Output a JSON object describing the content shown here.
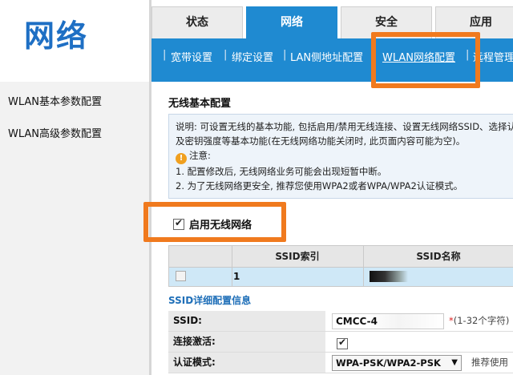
{
  "brand": {
    "title": "网络"
  },
  "sidebar": {
    "items": [
      {
        "label": "WLAN基本参数配置"
      },
      {
        "label": "WLAN高级参数配置"
      }
    ]
  },
  "tabs": [
    {
      "label": "状态"
    },
    {
      "label": "网络"
    },
    {
      "label": "安全"
    },
    {
      "label": "应用"
    }
  ],
  "subnav": {
    "items": [
      {
        "label": "宽带设置"
      },
      {
        "label": "绑定设置"
      },
      {
        "label": "LAN侧地址配置"
      },
      {
        "label": "WLAN网络配置"
      },
      {
        "label": "远程管理"
      }
    ]
  },
  "section": {
    "title": "无线基本配置"
  },
  "description": {
    "line1": "说明: 可设置无线的基本功能, 包括启用/禁用无线连接、设置无线网络SSID、选择认证模式",
    "line2": "及密钥强度等基本功能(在无线网络功能关闭时, 此页面内容可能为空)。",
    "note_title": "注意:",
    "note1": "1. 配置修改后, 无线网络业务可能会出现短暂中断。",
    "note2": "2. 为了无线网络更安全, 推荐您使用WPA2或者WPA/WPA2认证模式。"
  },
  "enable_wifi": {
    "label": "启用无线网络",
    "checked": true
  },
  "ssid_table": {
    "headers": [
      "",
      "SSID索引",
      "SSID名称"
    ],
    "rows": [
      {
        "index": "1"
      }
    ]
  },
  "detail": {
    "title": "SSID详细配置信息",
    "ssid_label": "SSID:",
    "ssid_value": "CMCC-4",
    "ssid_hint_star": "*",
    "ssid_hint": "(1-32个字符)",
    "activate_label": "连接激活:",
    "auth_label": "认证模式:",
    "auth_value": "WPA-PSK/WPA2-PSK",
    "auth_hint": "推荐使用"
  },
  "colors": {
    "accent": "#1f8ad1",
    "highlight": "#f07a1e",
    "brand": "#1e6fc4"
  }
}
